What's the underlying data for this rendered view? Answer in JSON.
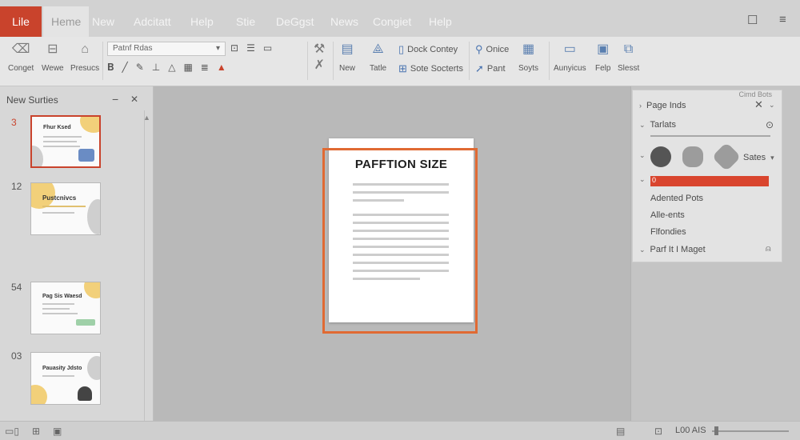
{
  "titlebar": {
    "file_tab": "Lile",
    "tabs": [
      "Heme",
      "New",
      "Adcitatt",
      "Help",
      "Stie",
      "DeGgst",
      "News",
      "Congiet",
      "Help"
    ],
    "win_restore": "☐",
    "win_menu": "≡"
  },
  "ribbon": {
    "left_buttons": [
      "Conget",
      "Wewe",
      "Presucs"
    ],
    "font_name": "Patnf Rdas",
    "font_dropdown": "▾",
    "right_small_1": "Dock Contey",
    "right_small_2": "Sote Socterts",
    "onice": "Onice",
    "pant": "Pant",
    "big_new": "New",
    "big_tatle": "Tatle",
    "big_soyts": "Soyts",
    "big_aunyicus": "Aunyicus",
    "big_felp": "Felp",
    "big_sleset": "Slesst"
  },
  "left_panel": {
    "header": "New Surties",
    "minimize": "−",
    "close": "✕",
    "scroll_up": "▲",
    "slides": [
      {
        "num": "3",
        "title": "Fhur Ksed"
      },
      {
        "num": "12",
        "title": "Pustcnivcs"
      },
      {
        "num": "54",
        "title": "Pag Sis Waesd"
      },
      {
        "num": "03",
        "title": "Pauasity Jdsto"
      }
    ]
  },
  "canvas": {
    "page_title": "PAFFTION SIZE"
  },
  "right_panel": {
    "top_tiny": "Cimd Bots",
    "page_inds": "Page Inds",
    "tarlats": "Tarlats",
    "sates": "Sates",
    "red_bar_value": "0",
    "adented": "Adented Pots",
    "allents": "Alle-ents",
    "flfondies": "Flfondies",
    "parf": "Parf It I Maget",
    "colors": {
      "accent": "#d9452e",
      "swatch_dark": "#555555",
      "swatch_light": "#9c9c9c"
    }
  },
  "statusbar": {
    "zoom_label": "L00 AIS"
  }
}
